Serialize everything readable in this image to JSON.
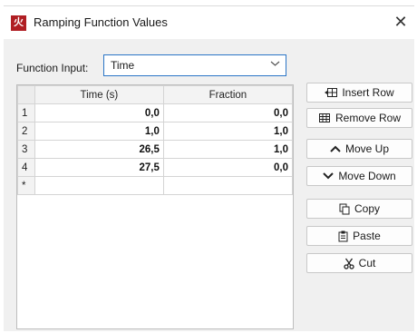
{
  "window": {
    "title": "Ramping Function Values",
    "app_icon_glyph": "火",
    "close_glyph": "✕"
  },
  "function_input": {
    "label": "Function Input:",
    "selected": "Time"
  },
  "grid": {
    "headers": [
      "Time (s)",
      "Fraction"
    ],
    "rows": [
      {
        "num": "1",
        "time": "0,0",
        "fraction": "0,0"
      },
      {
        "num": "2",
        "time": "1,0",
        "fraction": "1,0"
      },
      {
        "num": "3",
        "time": "26,5",
        "fraction": "1,0"
      },
      {
        "num": "4",
        "time": "27,5",
        "fraction": "0,0"
      }
    ],
    "new_row_marker": "*"
  },
  "buttons": {
    "insert_row": "Insert Row",
    "remove_row": "Remove Row",
    "move_up": "Move Up",
    "move_down": "Move Down",
    "copy": "Copy",
    "paste": "Paste",
    "cut": "Cut"
  },
  "colors": {
    "accent": "#2b75c6",
    "app_icon": "#b01e23"
  }
}
